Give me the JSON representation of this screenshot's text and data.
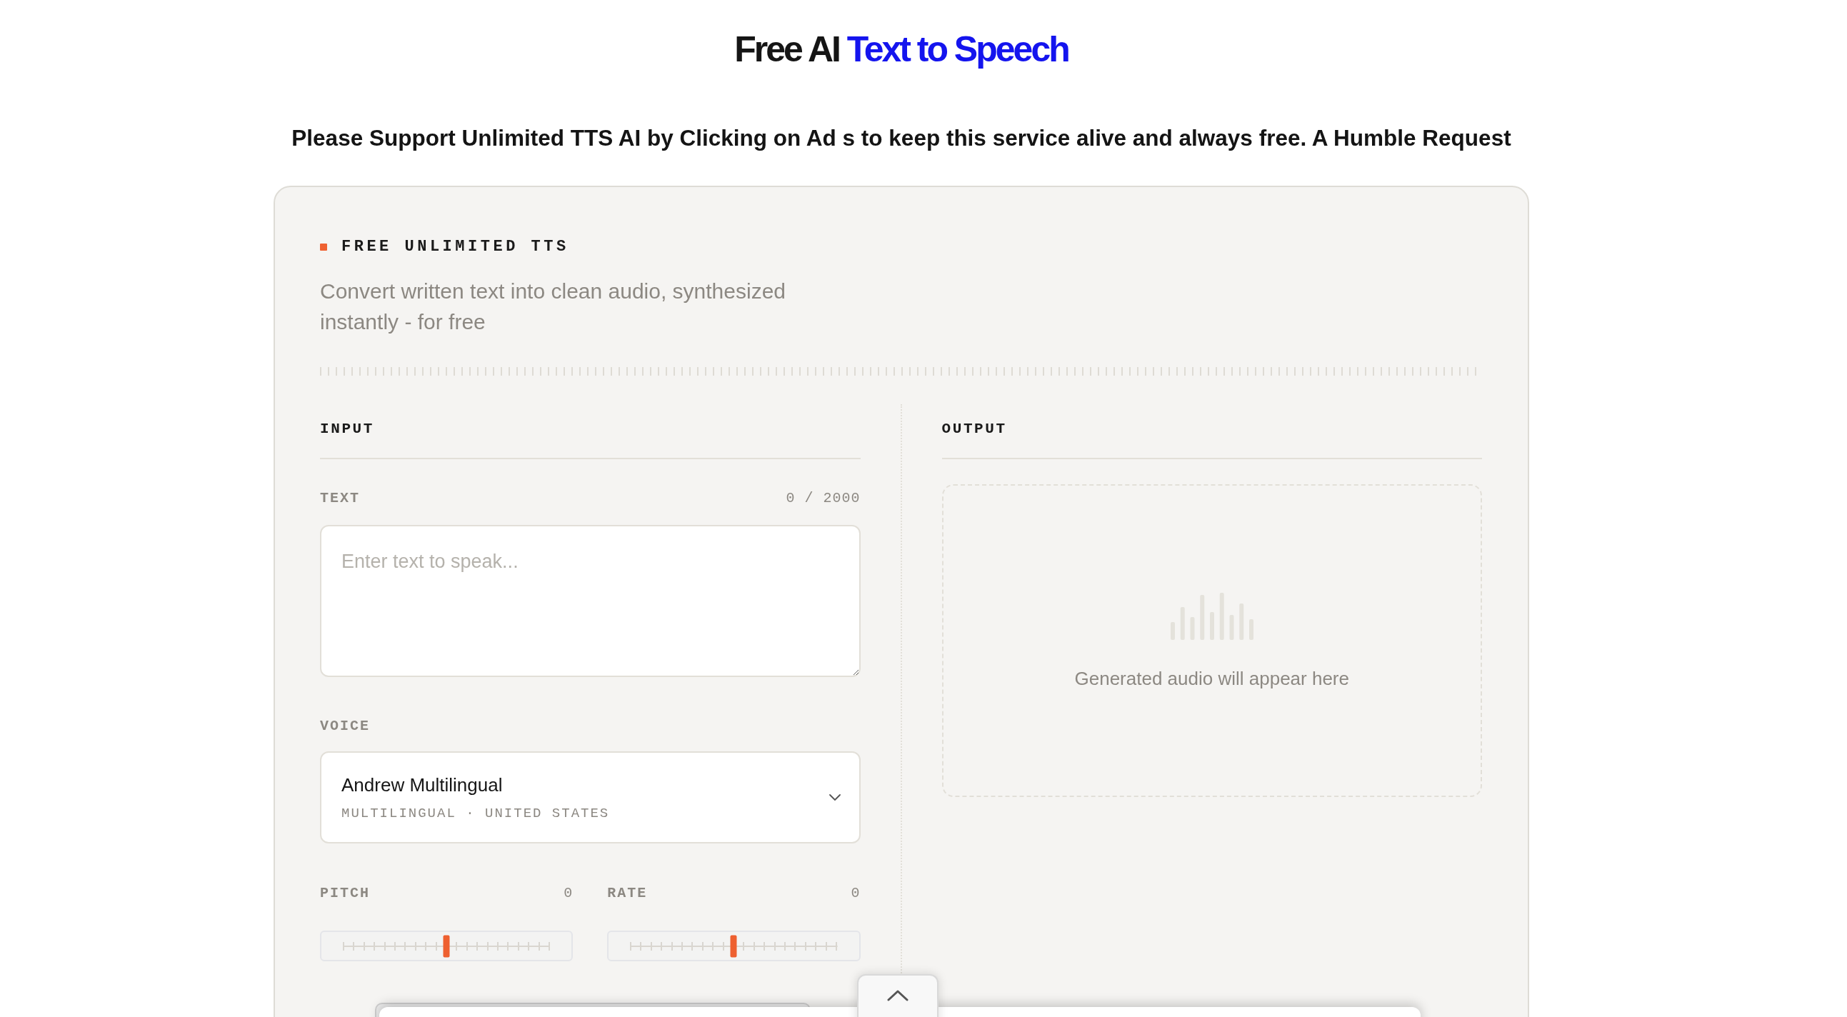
{
  "header": {
    "title": "Free AI",
    "title_accent": "Text to Speech",
    "notice": "Please Support Unlimited TTS AI by Clicking on Ad s to keep this service alive and always free. A Humble Request"
  },
  "card": {
    "eyebrow": "FREE UNLIMITED TTS",
    "description": "Convert written text into clean audio, synthesized instantly - for free"
  },
  "input": {
    "heading": "INPUT",
    "text_label": "TEXT",
    "char_count": "0 / 2000",
    "text_placeholder": "Enter text to speak...",
    "voice_label": "VOICE",
    "voice": {
      "name": "Andrew Multilingual",
      "details": "MULTILINGUAL · UNITED STATES"
    },
    "sliders": [
      {
        "label": "PITCH",
        "reading": "0",
        "level": 0.5
      },
      {
        "label": "RATE",
        "reading": "0",
        "level": 0.5
      }
    ]
  },
  "output": {
    "heading": "OUTPUT",
    "empty_message": "Generated audio will appear here"
  }
}
